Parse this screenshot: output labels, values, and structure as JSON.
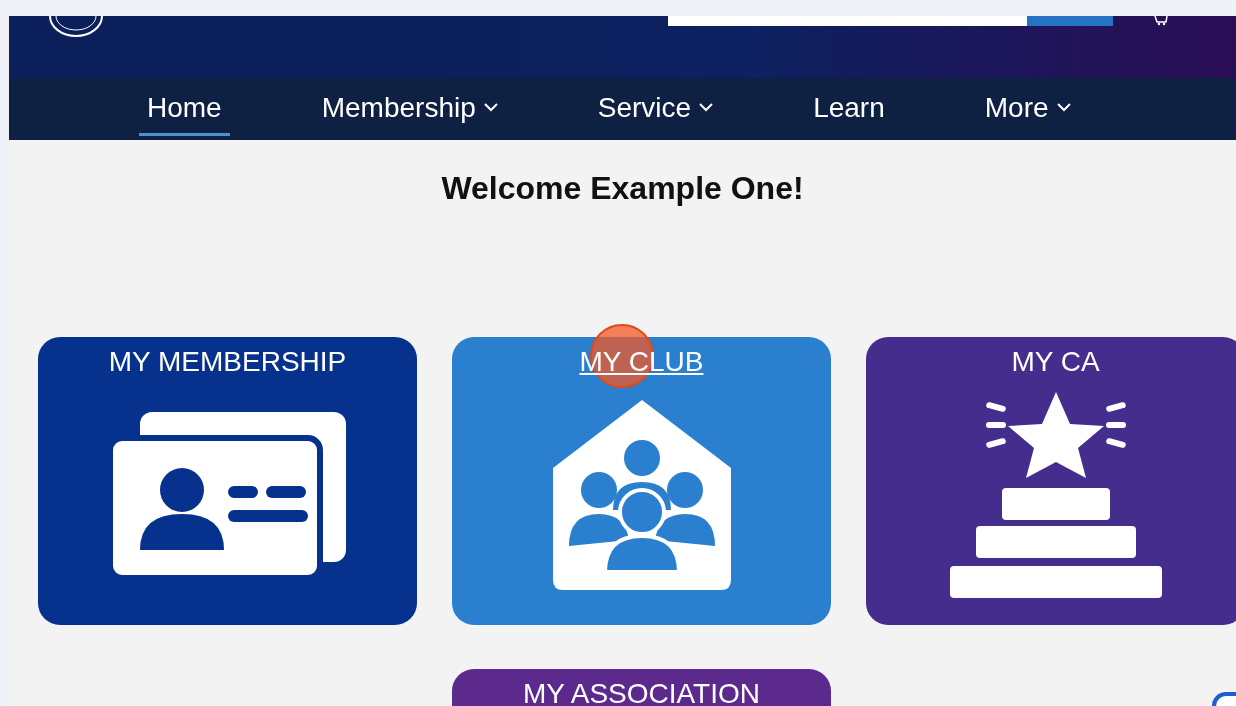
{
  "nav": [
    {
      "label": "Home",
      "selected": true,
      "dropdown": false
    },
    {
      "label": "Membership",
      "selected": false,
      "dropdown": true
    },
    {
      "label": "Service",
      "selected": false,
      "dropdown": true
    },
    {
      "label": "Learn",
      "selected": false,
      "dropdown": false
    },
    {
      "label": "More",
      "selected": false,
      "dropdown": true
    }
  ],
  "welcome": "Welcome Example One!",
  "tiles": [
    {
      "label": "MY MEMBERSHIP",
      "kind": "card",
      "color": "#06318c",
      "hovered": false
    },
    {
      "label": "MY CLUB",
      "kind": "house",
      "color": "#2a7fcf",
      "hovered": true
    },
    {
      "label": "MY CA",
      "kind": "podium",
      "color": "#452d8e",
      "hovered": false
    },
    {
      "label": "MY ASSOCIATION",
      "kind": "none",
      "color": "#5b2a8c",
      "hovered": false
    }
  ]
}
